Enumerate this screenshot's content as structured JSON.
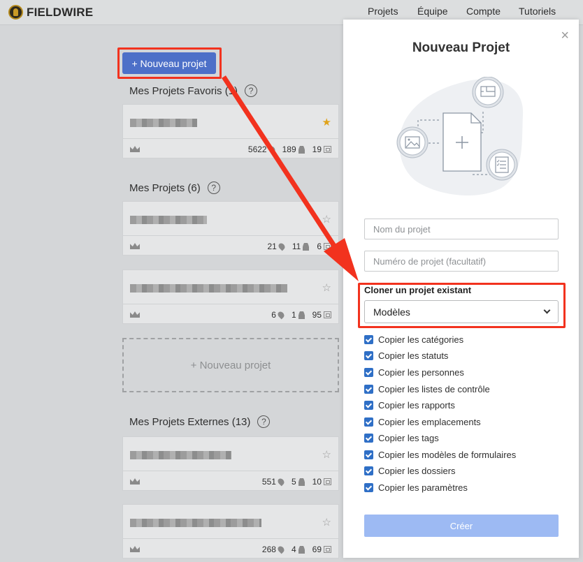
{
  "app": {
    "name": "FIELDWIRE"
  },
  "nav": {
    "items": [
      "Projets",
      "Équipe",
      "Compte",
      "Tutoriels"
    ]
  },
  "background": {
    "new_project_button": "+ Nouveau projet",
    "favorites_title": "Mes Projets Favoris (1)",
    "my_projects_title": "Mes Projets (6)",
    "external_title": "Mes Projets Externes (13)",
    "help": "?",
    "new_project_card": "+ Nouveau projet",
    "cards": [
      {
        "tasks": "5622",
        "people": "189",
        "plans": "19"
      },
      {
        "tasks": "21",
        "people": "11",
        "plans": "6"
      },
      {
        "tasks": "6",
        "people": "1",
        "plans": "95"
      },
      {
        "tasks": "551",
        "people": "5",
        "plans": "10"
      },
      {
        "tasks": "268",
        "people": "4",
        "plans": "69"
      }
    ]
  },
  "modal": {
    "title": "Nouveau Projet",
    "close": "×",
    "project_name_placeholder": "Nom du projet",
    "project_number_placeholder": "Numéro de projet (facultatif)",
    "clone_label": "Cloner un projet existant",
    "clone_selected": "Modèles",
    "checkboxes": [
      "Copier les catégories",
      "Copier les statuts",
      "Copier les personnes",
      "Copier les listes de contrôle",
      "Copier les rapports",
      "Copier les emplacements",
      "Copier les tags",
      "Copier les modèles de formulaires",
      "Copier les dossiers",
      "Copier les paramètres"
    ],
    "create_button": "Créer"
  },
  "colors": {
    "accent": "#4d70c8",
    "highlight": "#f2321e",
    "checkbox": "#2f6fc6",
    "create_disabled": "#9dbaf3"
  }
}
